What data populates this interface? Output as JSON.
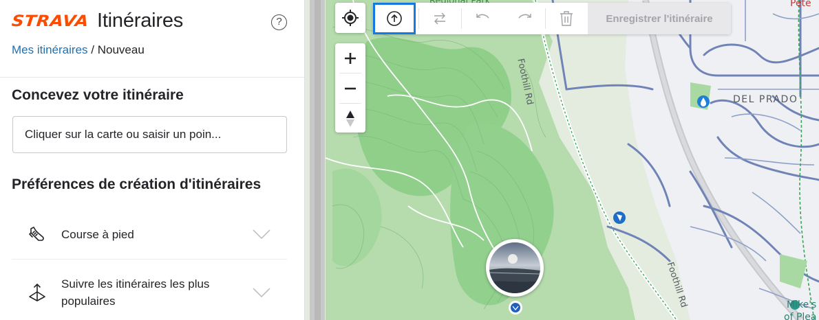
{
  "app": {
    "logo_text": "STRAVA",
    "title": "Itinéraires",
    "help_symbol": "?"
  },
  "breadcrumb": {
    "link": "Mes itinéraires",
    "separator": "/",
    "current": "Nouveau"
  },
  "design": {
    "heading": "Concevez votre itinéraire",
    "search_value": "Cliquer sur la carte ou saisir un poin..."
  },
  "preferences": {
    "heading": "Préférences de création d'itinéraires",
    "items": [
      {
        "label": "Course à pied",
        "icon": "running-shoe-icon"
      },
      {
        "label": "Suivre les itinéraires les plus populaires",
        "icon": "popularity-icon"
      }
    ]
  },
  "toolbar": {
    "save_label": "Enregistrer l'itinéraire",
    "buttons": [
      "upload-icon",
      "swap-icon",
      "undo-icon",
      "redo-icon",
      "trash-icon"
    ]
  },
  "map": {
    "labels": {
      "regional_park": "Regional Park",
      "foothill_rd_north": "Foothill Rd",
      "foothill_rd_south": "Foothill Rd",
      "del_prado": "DEL PRADO",
      "pete": "Pete",
      "mikes_line1": "Mike's",
      "mikes_line2": "of Plea"
    }
  },
  "colors": {
    "brand": "#fc4c02",
    "link": "#1a73b5",
    "active_outline": "#1479e3",
    "park_green": "#8fd08c",
    "road_blue": "#6f83b6"
  }
}
